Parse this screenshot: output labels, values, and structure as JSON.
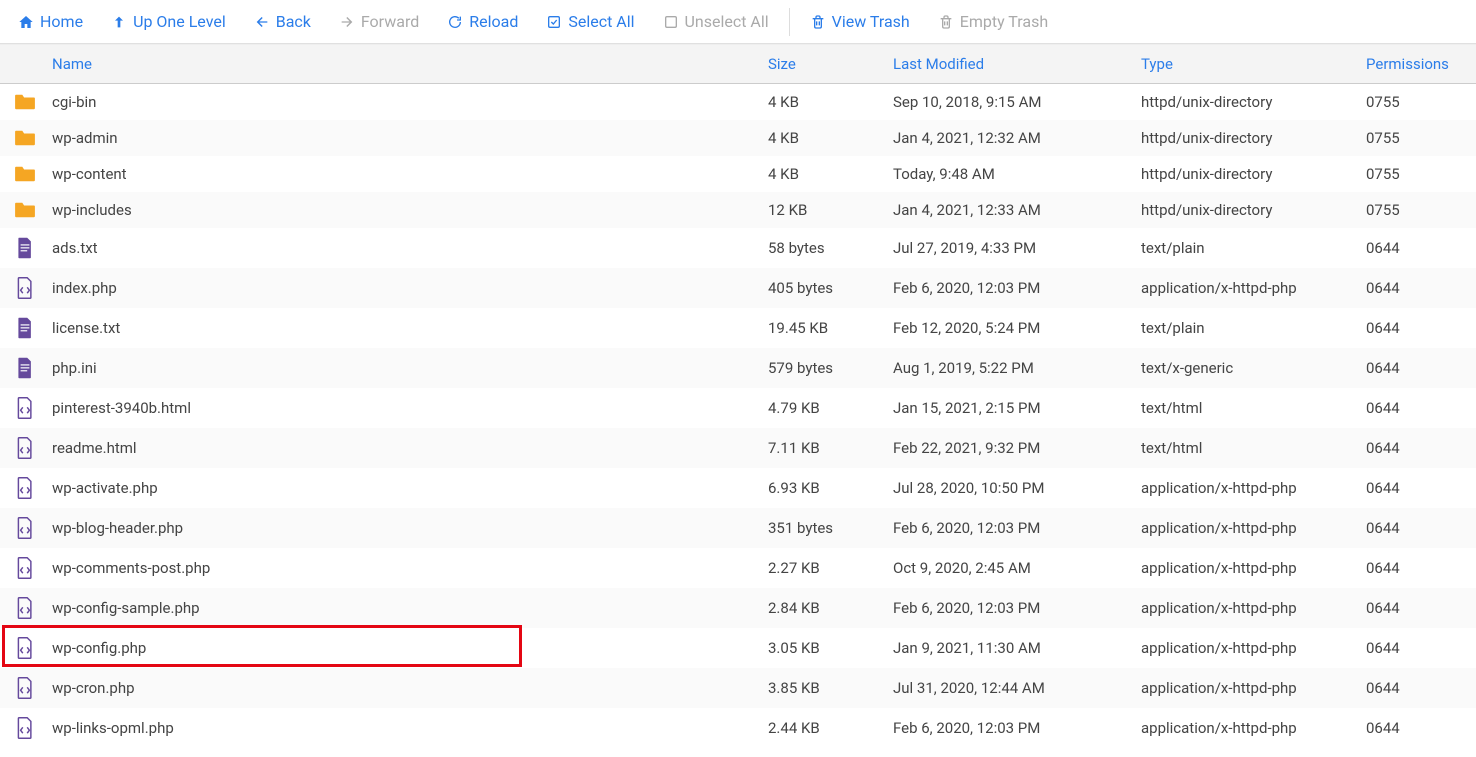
{
  "toolbar": {
    "home": "Home",
    "up": "Up One Level",
    "back": "Back",
    "forward": "Forward",
    "reload": "Reload",
    "select_all": "Select All",
    "unselect_all": "Unselect All",
    "view_trash": "View Trash",
    "empty_trash": "Empty Trash"
  },
  "headers": {
    "name": "Name",
    "size": "Size",
    "modified": "Last Modified",
    "type": "Type",
    "permissions": "Permissions"
  },
  "rows": [
    {
      "icon": "folder",
      "name": "cgi-bin",
      "size": "4 KB",
      "modified": "Sep 10, 2018, 9:15 AM",
      "type": "httpd/unix-directory",
      "perm": "0755"
    },
    {
      "icon": "folder",
      "name": "wp-admin",
      "size": "4 KB",
      "modified": "Jan 4, 2021, 12:32 AM",
      "type": "httpd/unix-directory",
      "perm": "0755"
    },
    {
      "icon": "folder",
      "name": "wp-content",
      "size": "4 KB",
      "modified": "Today, 9:48 AM",
      "type": "httpd/unix-directory",
      "perm": "0755"
    },
    {
      "icon": "folder",
      "name": "wp-includes",
      "size": "12 KB",
      "modified": "Jan 4, 2021, 12:33 AM",
      "type": "httpd/unix-directory",
      "perm": "0755"
    },
    {
      "icon": "text",
      "name": "ads.txt",
      "size": "58 bytes",
      "modified": "Jul 27, 2019, 4:33 PM",
      "type": "text/plain",
      "perm": "0644"
    },
    {
      "icon": "php",
      "name": "index.php",
      "size": "405 bytes",
      "modified": "Feb 6, 2020, 12:03 PM",
      "type": "application/x-httpd-php",
      "perm": "0644"
    },
    {
      "icon": "text",
      "name": "license.txt",
      "size": "19.45 KB",
      "modified": "Feb 12, 2020, 5:24 PM",
      "type": "text/plain",
      "perm": "0644"
    },
    {
      "icon": "text",
      "name": "php.ini",
      "size": "579 bytes",
      "modified": "Aug 1, 2019, 5:22 PM",
      "type": "text/x-generic",
      "perm": "0644"
    },
    {
      "icon": "code",
      "name": "pinterest-3940b.html",
      "size": "4.79 KB",
      "modified": "Jan 15, 2021, 2:15 PM",
      "type": "text/html",
      "perm": "0644"
    },
    {
      "icon": "code",
      "name": "readme.html",
      "size": "7.11 KB",
      "modified": "Feb 22, 2021, 9:32 PM",
      "type": "text/html",
      "perm": "0644"
    },
    {
      "icon": "php",
      "name": "wp-activate.php",
      "size": "6.93 KB",
      "modified": "Jul 28, 2020, 10:50 PM",
      "type": "application/x-httpd-php",
      "perm": "0644"
    },
    {
      "icon": "php",
      "name": "wp-blog-header.php",
      "size": "351 bytes",
      "modified": "Feb 6, 2020, 12:03 PM",
      "type": "application/x-httpd-php",
      "perm": "0644"
    },
    {
      "icon": "php",
      "name": "wp-comments-post.php",
      "size": "2.27 KB",
      "modified": "Oct 9, 2020, 2:45 AM",
      "type": "application/x-httpd-php",
      "perm": "0644"
    },
    {
      "icon": "php",
      "name": "wp-config-sample.php",
      "size": "2.84 KB",
      "modified": "Feb 6, 2020, 12:03 PM",
      "type": "application/x-httpd-php",
      "perm": "0644"
    },
    {
      "icon": "php",
      "name": "wp-config.php",
      "size": "3.05 KB",
      "modified": "Jan 9, 2021, 11:30 AM",
      "type": "application/x-httpd-php",
      "perm": "0644",
      "highlight": true
    },
    {
      "icon": "php",
      "name": "wp-cron.php",
      "size": "3.85 KB",
      "modified": "Jul 31, 2020, 12:44 AM",
      "type": "application/x-httpd-php",
      "perm": "0644"
    },
    {
      "icon": "php",
      "name": "wp-links-opml.php",
      "size": "2.44 KB",
      "modified": "Feb 6, 2020, 12:03 PM",
      "type": "application/x-httpd-php",
      "perm": "0644"
    }
  ]
}
